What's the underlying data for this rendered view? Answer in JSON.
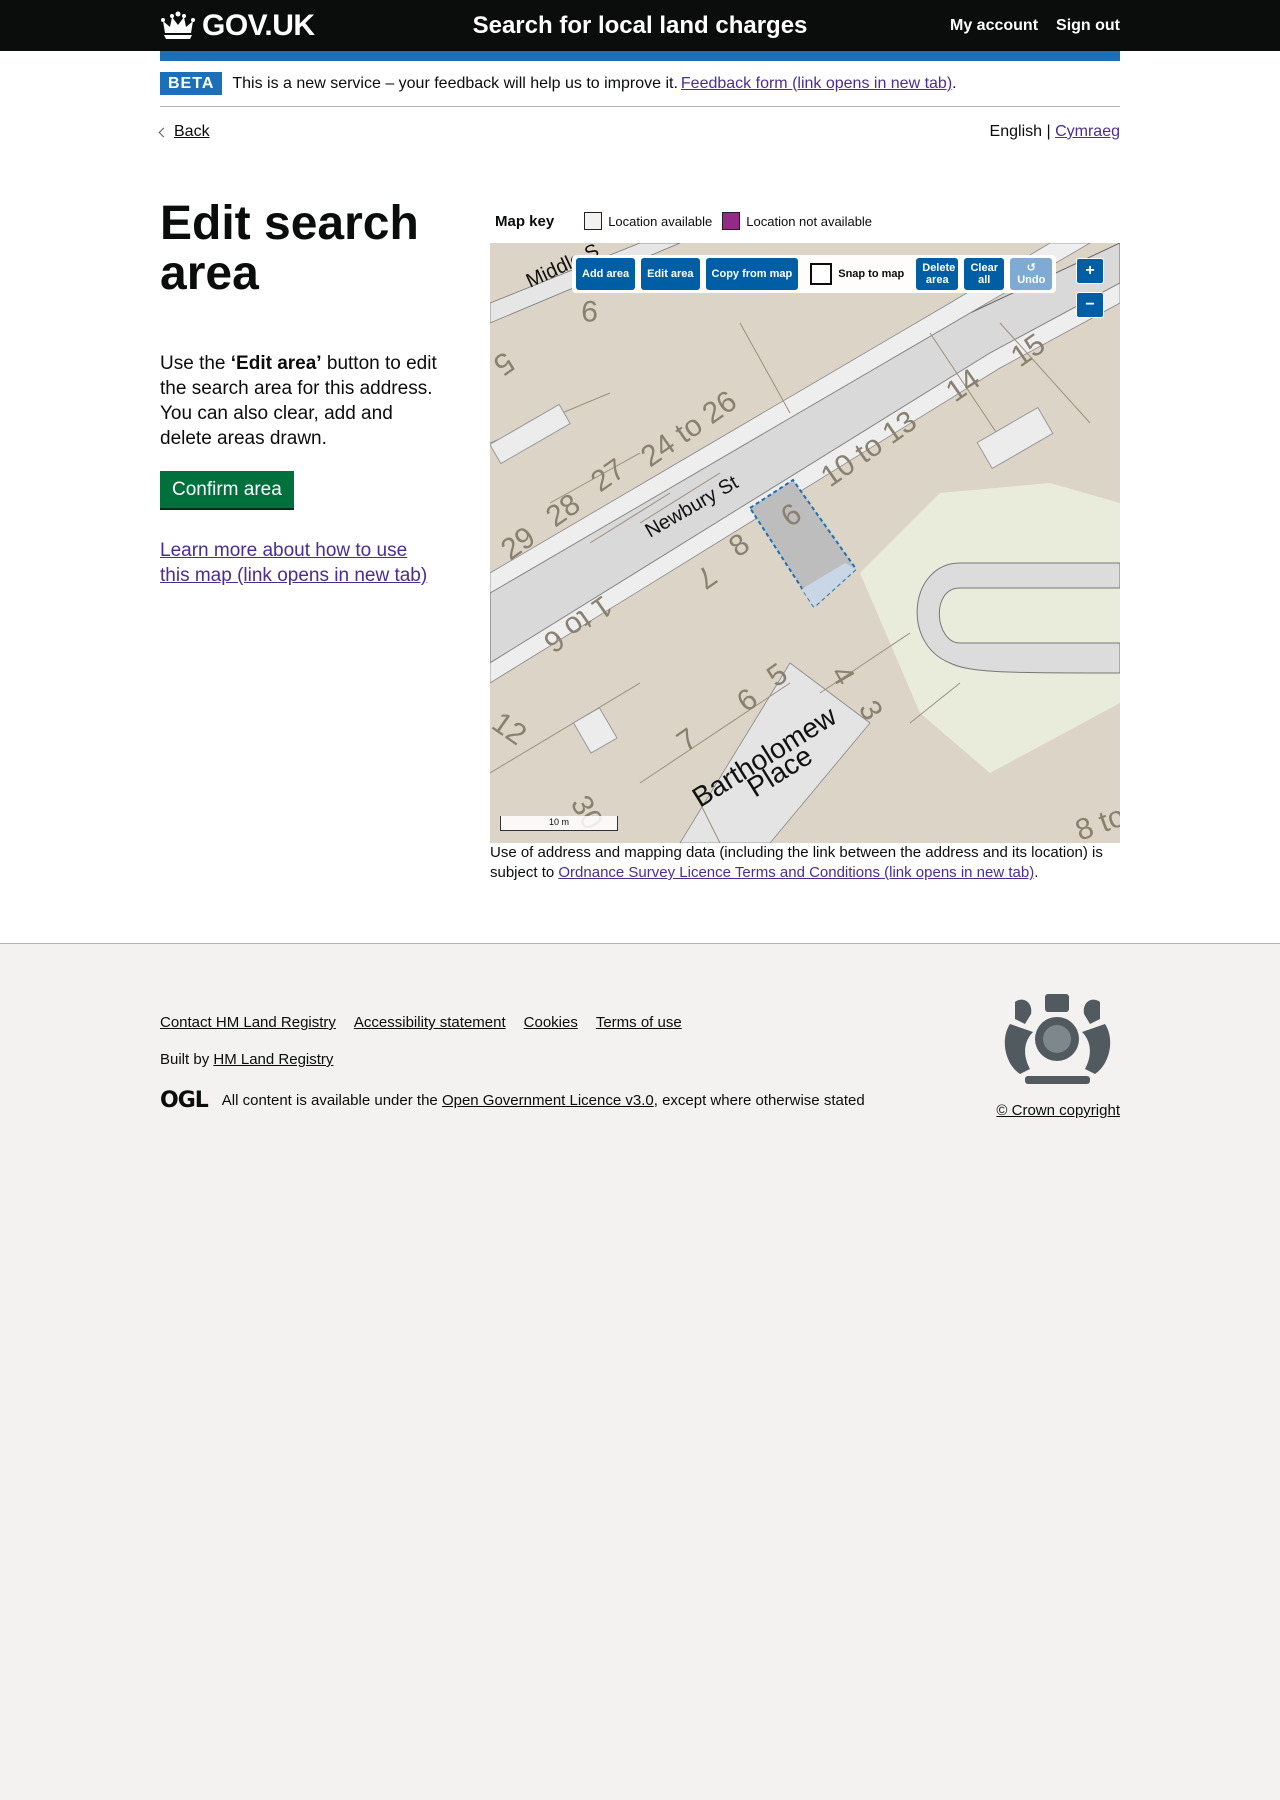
{
  "header": {
    "logo_text": "GOV.UK",
    "service_name": "Search for local land charges",
    "nav": [
      "My account",
      "Sign out"
    ]
  },
  "phase_banner": {
    "tag": "BETA",
    "text": "This is a new service – your feedback will help us to improve it.",
    "link": "Feedback form (link opens in new tab)",
    "end": "."
  },
  "nav_row": {
    "back": "Back",
    "lang_current": "English",
    "lang_sep": "|",
    "lang_other": "Cymraeg"
  },
  "main": {
    "title": "Edit search area",
    "intro_pre": "Use the ",
    "intro_bold": "‘Edit area’",
    "intro_post": " button to edit the search area for this address. You can also clear, add and delete areas drawn.",
    "confirm_button": "Confirm area",
    "learn_link": "Learn more about how to use this map (link opens in new tab)"
  },
  "map_key": {
    "title": "Map key",
    "available": "Location available",
    "not_available": "Location not available",
    "available_color": "#f3f2f1",
    "not_available_color": "#912b88"
  },
  "map": {
    "toolbar": {
      "add_area": "Add area",
      "edit_area": "Edit area",
      "copy_from_map": "Copy from map",
      "snap_to_map": "Snap to map",
      "delete_area": "Delete area",
      "clear_all": "Clear all",
      "undo": "Undo"
    },
    "zoom_in": "+",
    "zoom_out": "−",
    "scale": "10 m",
    "labels": {
      "street1": "Newbury St",
      "street2_line1": "Bartholomew",
      "street2_line2": "Place",
      "street3": "Middle S",
      "n24_26": "24 to 26",
      "n27": "27",
      "n28": "28",
      "n29": "29",
      "n10_13": "10 to 13",
      "n14": "14",
      "n15": "15",
      "n9top": "9",
      "n5top": "5",
      "n6": "6",
      "n8": "8",
      "n7a": "7",
      "n1_6": "1 to 6",
      "n12": "12",
      "n7b": "7",
      "n6b": "6",
      "n5b": "5",
      "n4": "4",
      "n3": "3",
      "n30": "30",
      "n8to": "8 to"
    }
  },
  "attribution": {
    "text": "Use of address and mapping data (including the link between the address and its location) is subject to",
    "link": "Ordnance Survey Licence Terms and Conditions (link opens in new tab)",
    "end": "."
  },
  "footer": {
    "links": [
      "Contact HM Land Registry",
      "Accessibility statement",
      "Cookies",
      "Terms of use"
    ],
    "built_by_pre": "Built by",
    "built_by_link": "HM Land Registry",
    "ogl_logo": "OGL",
    "licence_pre": "All content is available under the",
    "licence_link": "Open Government Licence v3.0",
    "licence_post": ", except where otherwise stated",
    "copyright": "© Crown copyright"
  }
}
